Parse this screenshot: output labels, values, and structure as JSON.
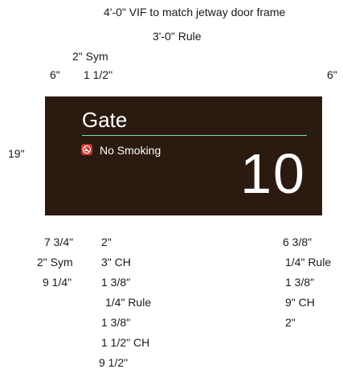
{
  "dimensions_top": {
    "overall": "4'-0\" VIF to match jetway door frame",
    "rule": "3'-0\" Rule",
    "sym": "2\" Sym",
    "left_margin": "6\"",
    "inset": "1 1/2\"",
    "right_margin": "6\""
  },
  "dimensions_side": {
    "height": "19\""
  },
  "sign": {
    "gate_label": "Gate",
    "notice_text": "No Smoking",
    "gate_number": "10",
    "colors": {
      "background": "#2a1a10",
      "text": "#ffffff",
      "rule": "#7fd9b8",
      "icon": "#c4342b"
    },
    "icon": "no-smoking-icon"
  },
  "dimensions_bottom_left": [
    "7 3/4\"",
    "2\" Sym",
    "9 1/4\""
  ],
  "dimensions_bottom_mid": [
    "2\"",
    "3\" CH",
    "1 3/8\"",
    "1/4\" Rule",
    "1 3/8\"",
    "1 1/2\" CH",
    "9 1/2\""
  ],
  "dimensions_bottom_right": [
    "6 3/8\"",
    "1/4\" Rule",
    "1 3/8\"",
    "9\" CH",
    "2\""
  ]
}
